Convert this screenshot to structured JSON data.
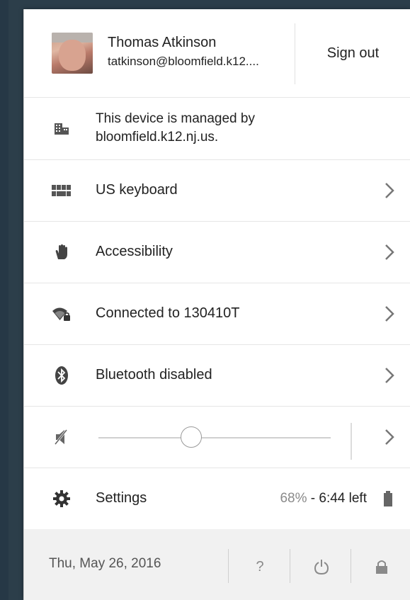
{
  "user": {
    "name": "Thomas Atkinson",
    "email": "tatkinson@bloomfield.k12....",
    "sign_out_label": "Sign out"
  },
  "managed": {
    "line1": "This device is managed by",
    "line2": "bloomfield.k12.nj.us."
  },
  "menu": {
    "keyboard": "US keyboard",
    "accessibility": "Accessibility",
    "network": "Connected to 130410T",
    "bluetooth": "Bluetooth disabled",
    "settings": "Settings"
  },
  "volume": {
    "muted": true,
    "level": 0.4
  },
  "battery": {
    "percent": "68%",
    "separator": " - ",
    "time_left": "6:44 left"
  },
  "footer": {
    "date": "Thu, May 26, 2016",
    "help": "?"
  },
  "colors": {
    "panel_bg": "#ffffff",
    "footer_bg": "#f1f1f1",
    "desktop_bg": "#2c3e4a"
  }
}
